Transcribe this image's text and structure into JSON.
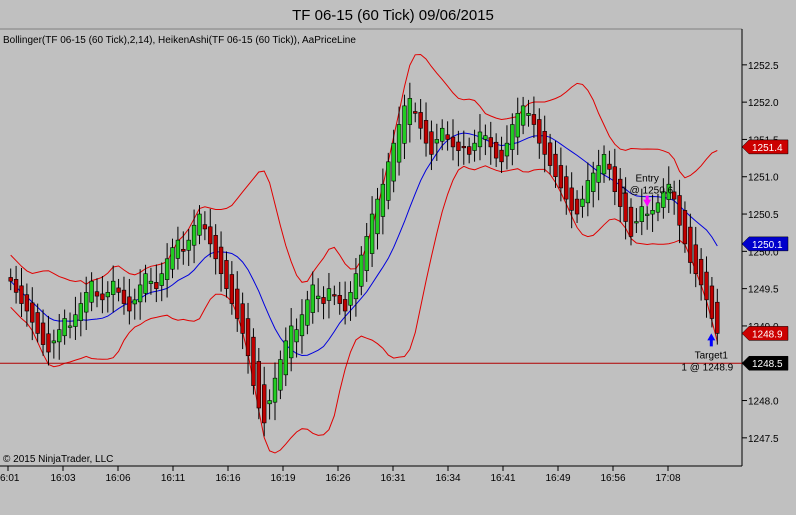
{
  "chart_data": {
    "type": "candlestick",
    "title": "TF 06-15 (60 Tick)  09/06/2015",
    "indicators_label": "Bollinger(TF 06-15 (60 Tick),2,14), HeikenAshi(TF 06-15 (60 Tick)), AaPriceLine",
    "copyright": "© 2015 NinjaTrader, LLC",
    "ylim": [
      1247.3,
      1253.0
    ],
    "y_ticks": [
      "1252.5",
      "1252.0",
      "1251.5",
      "1251.0",
      "1250.5",
      "1250.0",
      "1249.5",
      "1249.0",
      "1248.5",
      "1248.0",
      "1247.5"
    ],
    "x_ticks": [
      "6:01",
      "16:03",
      "16:06",
      "16:11",
      "16:16",
      "16:19",
      "16:26",
      "16:31",
      "16:34",
      "16:41",
      "16:49",
      "16:56",
      "17:08"
    ],
    "price_line": 1248.5,
    "price_line_label": "1248.5",
    "badges": [
      {
        "value": 1251.4,
        "label": "1251.4",
        "color": "#cc0000"
      },
      {
        "value": 1250.1,
        "label": "1250.1",
        "color": "#0000cc"
      },
      {
        "value": 1248.9,
        "label": "1248.9",
        "color": "#cc0000"
      }
    ],
    "entry": {
      "title": "Entry",
      "detail": "1 @ 1250.6",
      "bar": 118,
      "price": 1250.6
    },
    "target": {
      "title": "Target1",
      "detail": "1 @ 1248.9",
      "bar": 131,
      "price": 1248.9
    },
    "closes": [
      1249.6,
      1249.45,
      1249.3,
      1249.2,
      1249.05,
      1248.9,
      1248.75,
      1248.65,
      1248.8,
      1248.95,
      1249.1,
      1249.0,
      1249.15,
      1249.3,
      1249.45,
      1249.6,
      1249.4,
      1249.35,
      1249.45,
      1249.6,
      1249.45,
      1249.3,
      1249.2,
      1249.35,
      1249.55,
      1249.7,
      1249.6,
      1249.5,
      1249.7,
      1249.9,
      1250.05,
      1250.15,
      1250.0,
      1250.15,
      1250.35,
      1250.5,
      1250.3,
      1250.1,
      1249.9,
      1249.7,
      1249.5,
      1249.3,
      1249.1,
      1248.9,
      1248.6,
      1248.2,
      1247.9,
      1247.7,
      1248.0,
      1248.3,
      1248.55,
      1248.8,
      1249.0,
      1248.95,
      1249.15,
      1249.35,
      1249.55,
      1249.4,
      1249.3,
      1249.5,
      1249.4,
      1249.3,
      1249.2,
      1249.45,
      1249.7,
      1249.95,
      1250.2,
      1250.5,
      1250.7,
      1250.9,
      1251.2,
      1251.45,
      1251.7,
      1251.95,
      1252.05,
      1251.85,
      1251.65,
      1251.45,
      1251.3,
      1251.5,
      1251.65,
      1251.5,
      1251.4,
      1251.35,
      1251.4,
      1251.3,
      1251.45,
      1251.6,
      1251.55,
      1251.4,
      1251.25,
      1251.2,
      1251.45,
      1251.7,
      1251.85,
      1251.95,
      1251.85,
      1251.7,
      1251.45,
      1251.3,
      1251.15,
      1251.0,
      1250.85,
      1250.7,
      1250.55,
      1250.5,
      1250.7,
      1250.95,
      1251.05,
      1251.15,
      1251.3,
      1251.1,
      1250.8,
      1250.6,
      1250.4,
      1250.2,
      1250.4,
      1250.6,
      1250.5,
      1250.55,
      1250.65,
      1250.8,
      1250.9,
      1250.7,
      1250.35,
      1250.1,
      1249.85,
      1249.7,
      1249.55,
      1249.35,
      1249.1,
      1248.9
    ]
  }
}
